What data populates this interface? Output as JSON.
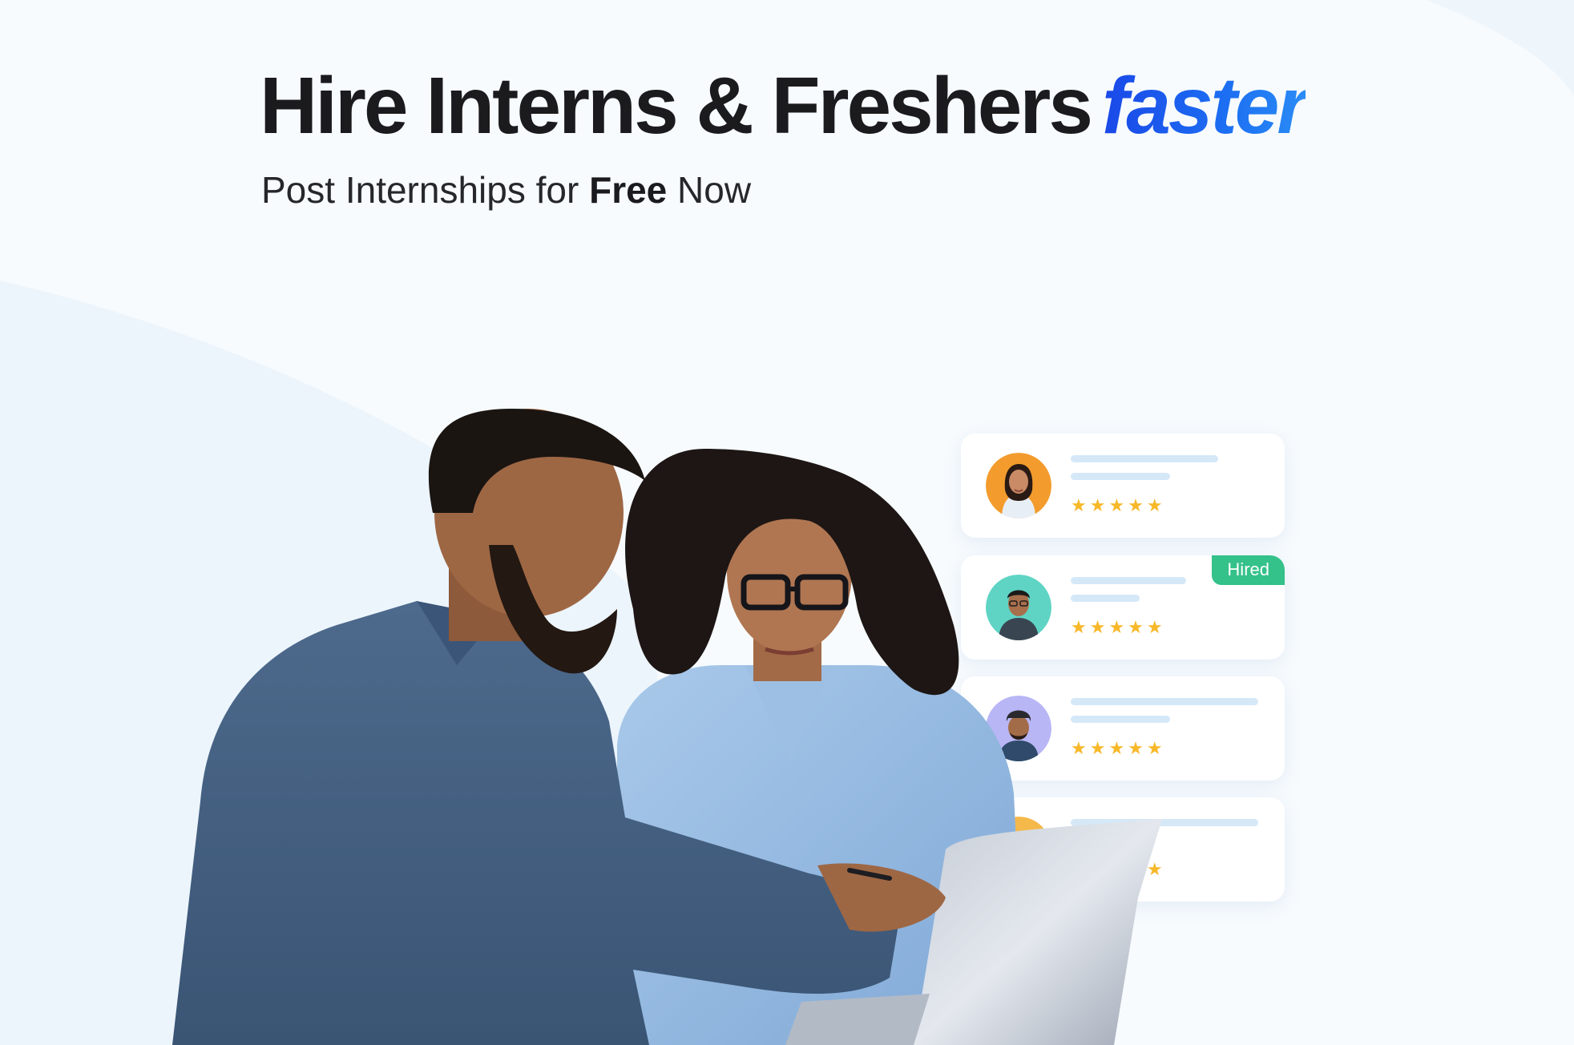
{
  "hero": {
    "headline_main": "Hire Interns & Freshers",
    "headline_accent": "faster",
    "subline_pre": "Post Internships for ",
    "subline_bold": "Free",
    "subline_post": " Now"
  },
  "cards": [
    {
      "stars": "★★★★★",
      "rating": 5,
      "badge": ""
    },
    {
      "stars": "★★★★★",
      "rating": 5,
      "badge": "Hired"
    },
    {
      "stars": "★★★★★",
      "rating": 5,
      "badge": ""
    },
    {
      "stars": "★★★★★",
      "rating": 5,
      "badge": ""
    }
  ],
  "colors": {
    "accent": "#1a5cf0",
    "star": "#f7b829",
    "hired_badge": "#34c18a",
    "headline": "#1b1b1d"
  }
}
